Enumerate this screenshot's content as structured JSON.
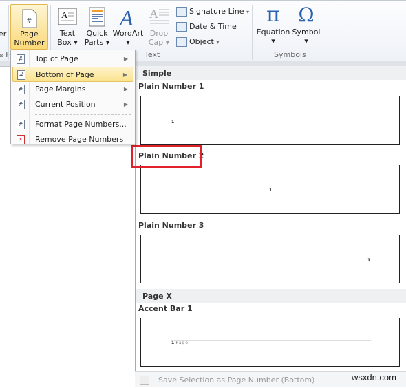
{
  "ribbon": {
    "partial_left": "er",
    "partial_group": "& F",
    "page_number": {
      "line1": "Page",
      "line2": "Number"
    },
    "text_box": {
      "line1": "Text",
      "line2": "Box"
    },
    "quick_parts": {
      "line1": "Quick",
      "line2": "Parts"
    },
    "wordart": "WordArt",
    "drop_cap": {
      "line1": "Drop",
      "line2": "Cap"
    },
    "signature_line": "Signature Line",
    "date_time": "Date & Time",
    "object": "Object",
    "equation": "Equation",
    "symbol": "Symbol",
    "groups": {
      "text": "Text",
      "symbols": "Symbols"
    }
  },
  "menu": {
    "items": [
      {
        "label": "Top of Page",
        "submenu": true
      },
      {
        "label": "Bottom of Page",
        "submenu": true,
        "highlighted": true
      },
      {
        "label": "Page Margins",
        "submenu": true
      },
      {
        "label": "Current Position",
        "submenu": true
      },
      {
        "label": "Format Page Numbers..."
      },
      {
        "label": "Remove Page Numbers"
      }
    ]
  },
  "gallery": {
    "sections": [
      {
        "title": "Simple"
      },
      {
        "title": "Page X"
      }
    ],
    "items": [
      {
        "label": "Plain Number 1",
        "preview": "1"
      },
      {
        "label": "Plain Number 2",
        "preview": "1",
        "highlighted_red": true
      },
      {
        "label": "Plain Number 3",
        "preview": "1"
      },
      {
        "label": "Accent Bar 1",
        "preview_num": "1",
        "preview_text": "Page"
      }
    ],
    "footer": "Save Selection as Page Number (Bottom)"
  },
  "watermark": "wsxdn.com",
  "colors": {
    "highlight": "#fbe38e",
    "red_box": "#e0202a",
    "icon_blue": "#2a62b0"
  }
}
